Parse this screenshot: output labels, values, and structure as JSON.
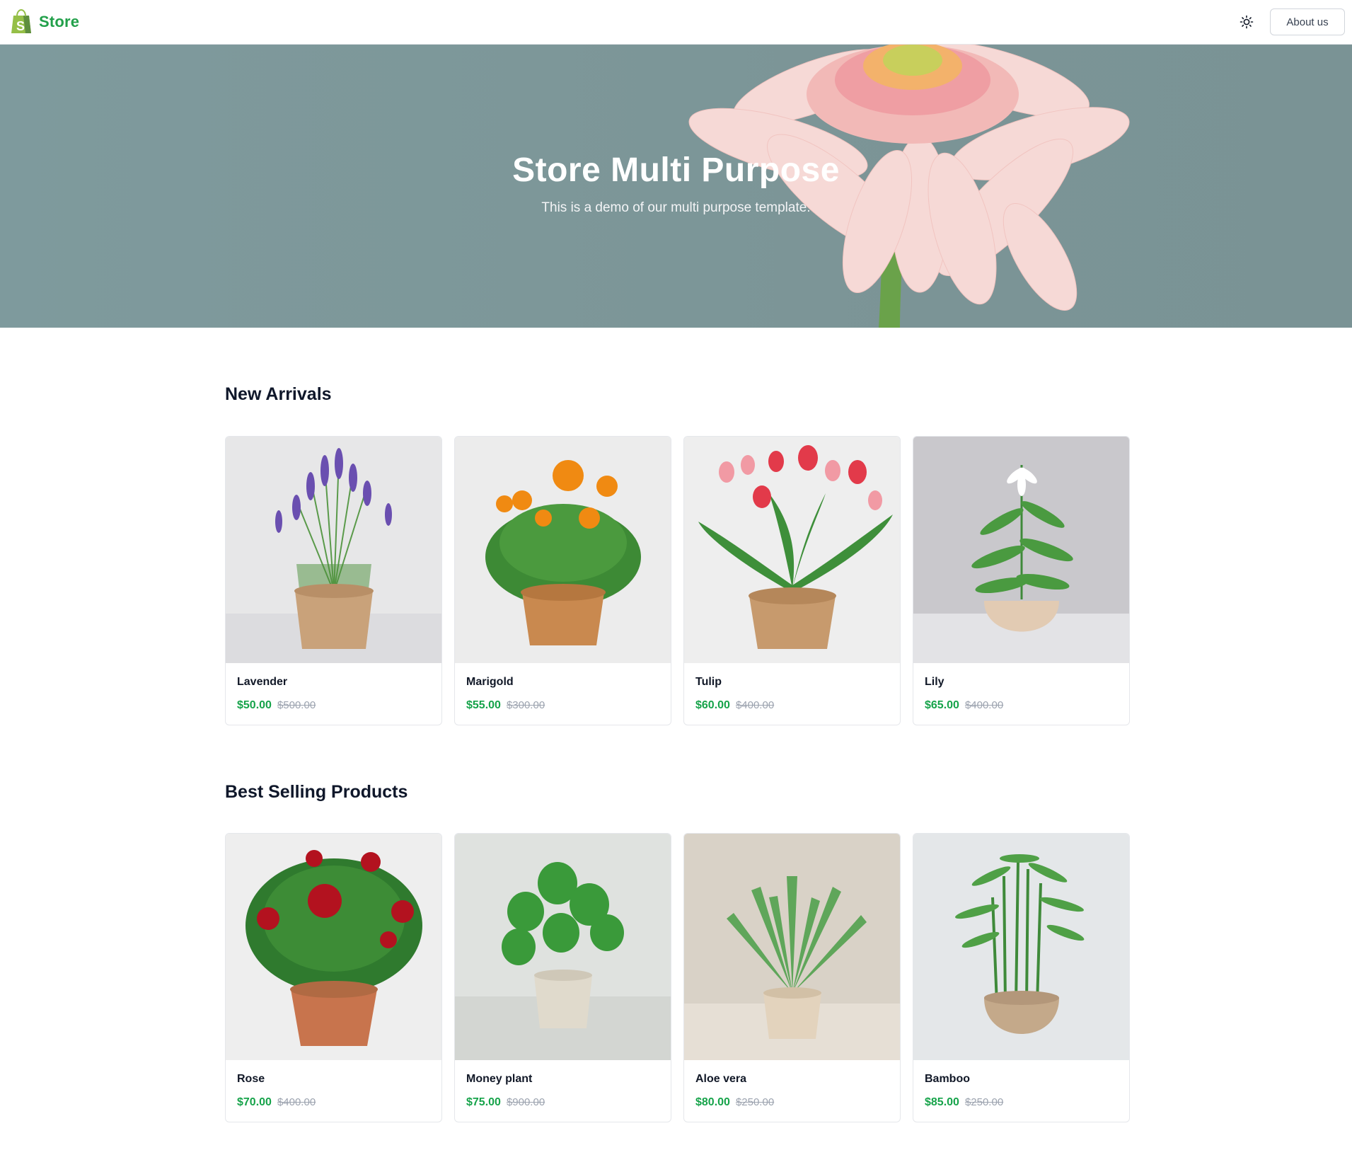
{
  "header": {
    "brand": "Store",
    "about_label": "About us",
    "theme_icon": "sun-icon"
  },
  "hero": {
    "title": "Store Multi Purpose",
    "subtitle": "This is a demo of our multi purpose template."
  },
  "colors": {
    "brand_green": "#22a04a",
    "price_green": "#16a34a",
    "old_price_gray": "#9ca3af"
  },
  "new_arrivals": {
    "title": "New Arrivals",
    "products": [
      {
        "name": "Lavender",
        "price": "$50.00",
        "old_price": "$500.00"
      },
      {
        "name": "Marigold",
        "price": "$55.00",
        "old_price": "$300.00"
      },
      {
        "name": "Tulip",
        "price": "$60.00",
        "old_price": "$400.00"
      },
      {
        "name": "Lily",
        "price": "$65.00",
        "old_price": "$400.00"
      }
    ]
  },
  "best_selling": {
    "title": "Best Selling Products",
    "products": [
      {
        "name": "Rose",
        "price": "$70.00",
        "old_price": "$400.00"
      },
      {
        "name": "Money plant",
        "price": "$75.00",
        "old_price": "$900.00"
      },
      {
        "name": "Aloe vera",
        "price": "$80.00",
        "old_price": "$250.00"
      },
      {
        "name": "Bamboo",
        "price": "$85.00",
        "old_price": "$250.00"
      }
    ]
  }
}
